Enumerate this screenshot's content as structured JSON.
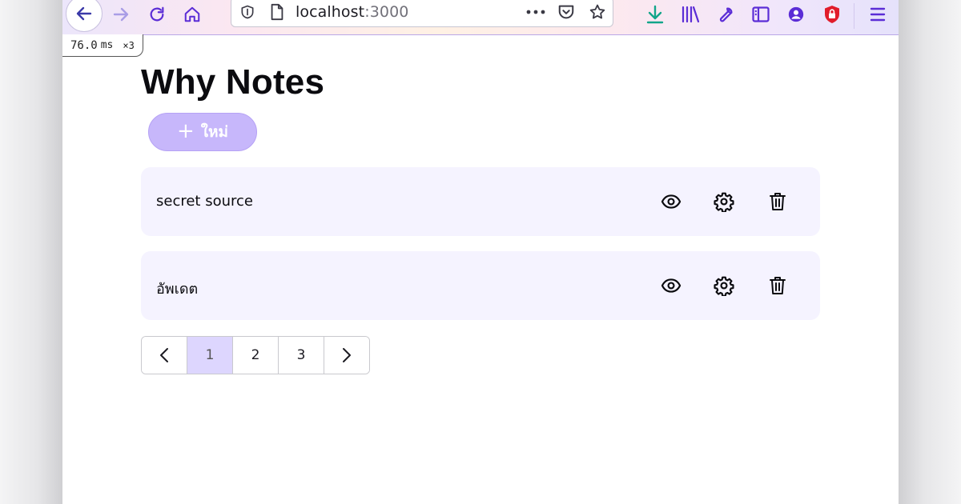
{
  "browser": {
    "url_host": "localhost",
    "url_port": ":3000",
    "icons": {
      "back": "arrow-left-icon",
      "forward": "arrow-right-icon",
      "reload": "reload-icon",
      "home": "home-icon",
      "tracking": "shield-icon",
      "page": "page-icon",
      "more": "more-dots-icon",
      "pocket": "pocket-icon",
      "bookmark": "star-icon",
      "downloads": "download-icon",
      "library": "library-icon",
      "devtools": "wrench-icon",
      "sidebar": "sidebar-icon",
      "account": "account-icon",
      "addon": "red-shield-lock-icon",
      "menu": "hamburger-menu-icon"
    },
    "colors": {
      "accent": "#5b2dd6",
      "download": "#12a58a",
      "addon": "#e11d2b"
    }
  },
  "perf_badge": {
    "value": "76.0",
    "unit": "ms",
    "multiplier": "×3"
  },
  "app": {
    "title": "Why Notes",
    "new_button": {
      "icon": "+",
      "label": "ใหม่"
    },
    "notes": [
      {
        "title": "secret source",
        "actions": [
          "eye-icon",
          "gear-icon",
          "trash-icon"
        ]
      },
      {
        "title": "อัพเดต",
        "actions": [
          "eye-icon",
          "gear-icon",
          "trash-icon"
        ]
      }
    ],
    "pagination": {
      "prev": "‹",
      "pages": [
        "1",
        "2",
        "3"
      ],
      "current": "1",
      "next": "›"
    },
    "colors": {
      "card_bg": "#f5f3ff",
      "button_bg": "#c7b7fb",
      "active_page_bg": "#ddd6fe"
    }
  }
}
